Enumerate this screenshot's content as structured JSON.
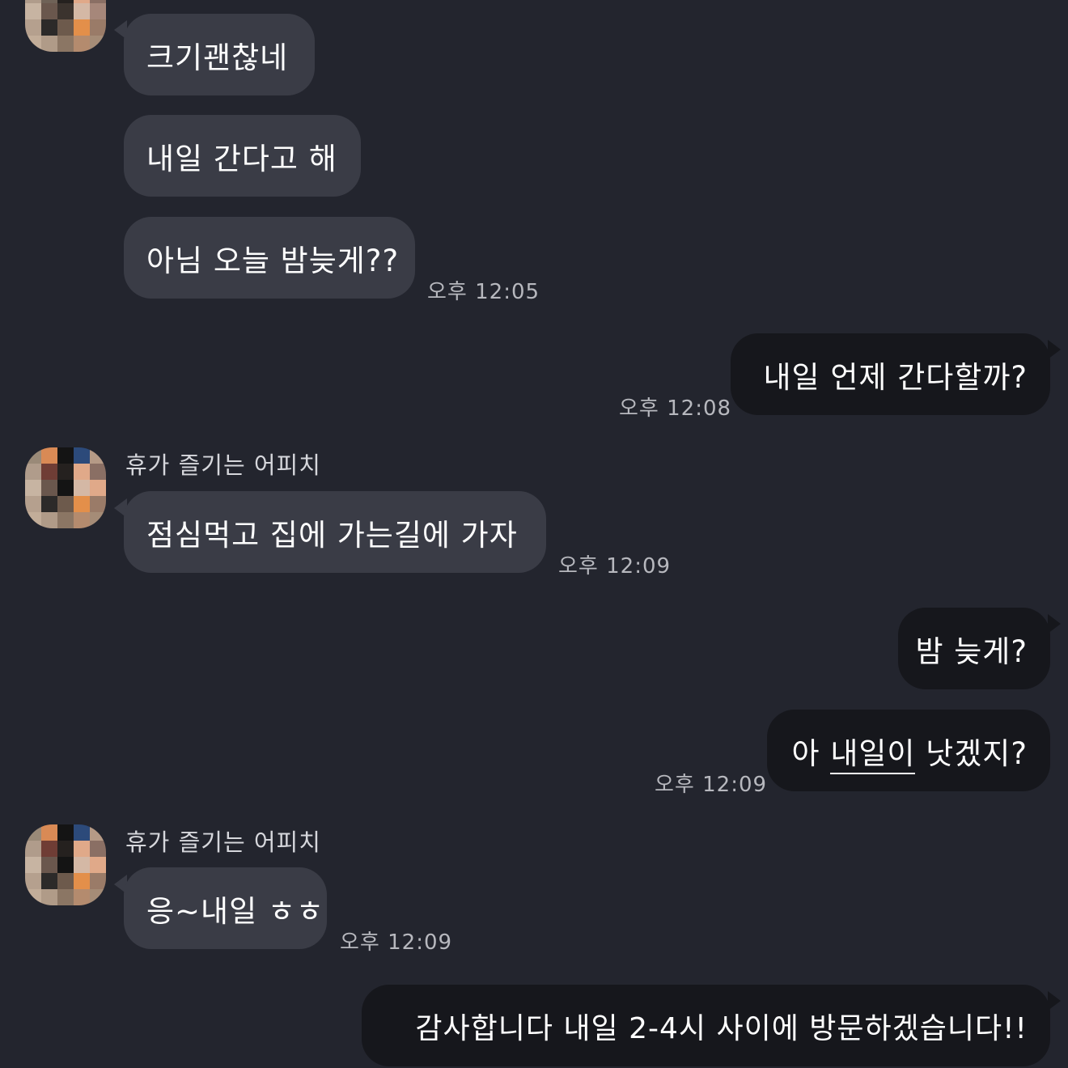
{
  "chat": {
    "sender_name": "휴가 즐기는 어피치",
    "messages": [
      {
        "text": "크기괜찮네"
      },
      {
        "text": "내일 간다고 해"
      },
      {
        "text": "아님 오늘 밤늦게??",
        "time": "오후 12:05"
      },
      {
        "text": "내일 언제 간다할까?",
        "time": "오후 12:08"
      },
      {
        "text": "점심먹고 집에 가는길에 가자",
        "time": "오후 12:09"
      },
      {
        "text": "밤 늦게?"
      },
      {
        "text_before": "아 ",
        "text_underlined": "내일이",
        "text_after": " 낫겠지?",
        "time": "오후 12:09"
      },
      {
        "text": "응~내일 ㅎㅎ",
        "time": "오후 12:09"
      },
      {
        "text": "감사합니다 내일 2-4시 사이에 방문하겠습니다!!"
      }
    ]
  },
  "colors": {
    "background": "#23252e",
    "received_bubble": "#3a3c46",
    "sent_bubble": "#16171c",
    "text": "#ffffff",
    "timestamp": "#b7b8be"
  },
  "avatar": {
    "icon": "blurred-profile-image"
  }
}
